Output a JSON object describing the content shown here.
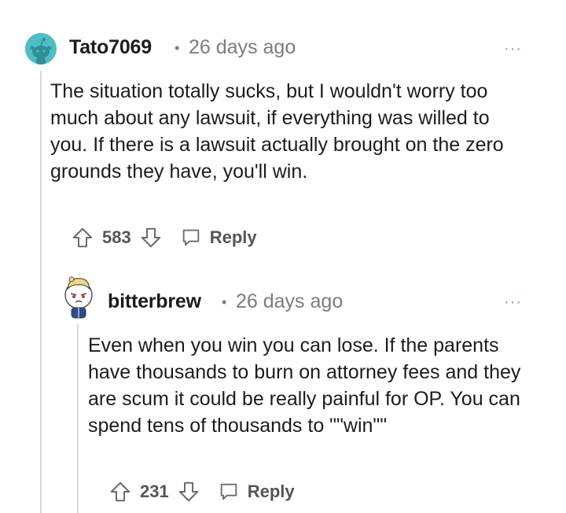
{
  "comments": [
    {
      "username": "Tato7069",
      "separator": "•",
      "timestamp": "26 days ago",
      "more": "···",
      "body": "The situation totally sucks, but I wouldn't worry too much about any lawsuit, if everything was willed to you. If there is a lawsuit actually brought on the zero grounds they have, you'll win.",
      "score": "583",
      "reply_label": "Reply",
      "avatar_color": "#4fbdc4"
    },
    {
      "username": "bitterbrew",
      "separator": "•",
      "timestamp": "26 days ago",
      "more": "···",
      "body": "Even when you win you can lose. If the parents have thousands to burn on attorney fees and they are scum it could be really painful for OP. You can spend tens of thousands to \"\"win\"\"",
      "score": "231",
      "reply_label": "Reply"
    }
  ],
  "icons": [
    "upvote-icon",
    "downvote-icon",
    "reply-icon",
    "more-options-icon"
  ]
}
